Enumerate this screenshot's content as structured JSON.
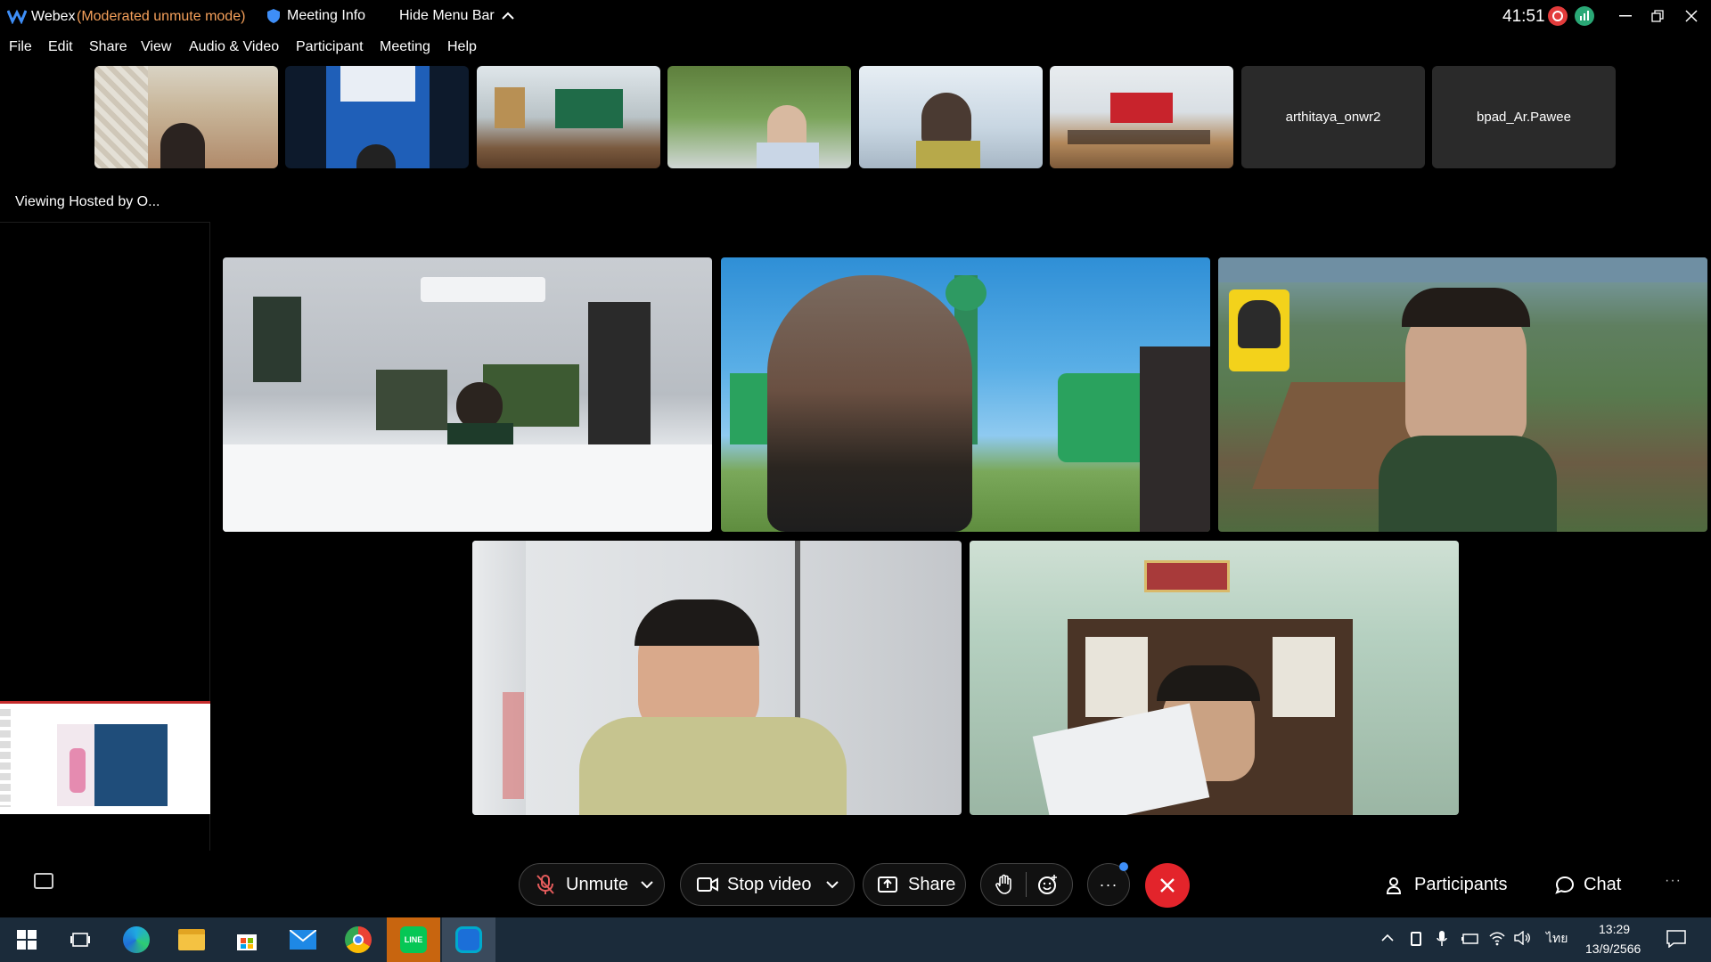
{
  "titlebar": {
    "app": "Webex",
    "mode": "(Moderated unmute mode)",
    "meeting_info": "Meeting Info",
    "hide_menu": "Hide Menu Bar",
    "timer": "41:51"
  },
  "menu": {
    "items": [
      "File",
      "Edit",
      "Share",
      "View",
      "Audio & Video",
      "Participant",
      "Meeting",
      "Help"
    ]
  },
  "filmstrip": {
    "names": [
      "arthitaya_onwr2",
      "bpad_Ar.Pawee"
    ]
  },
  "stage": {
    "viewing_label": "Viewing Hosted by O..."
  },
  "controls": {
    "unmute": "Unmute",
    "stop_video": "Stop video",
    "share": "Share",
    "participants": "Participants",
    "chat": "Chat"
  },
  "taskbar": {
    "time": "13:29",
    "date": "13/9/2566",
    "lang": "ไทย"
  },
  "colors": {
    "accent_end": "#e3242b",
    "mode_text": "#f5a05a",
    "taskbar_bg": "#1b2b3a"
  }
}
